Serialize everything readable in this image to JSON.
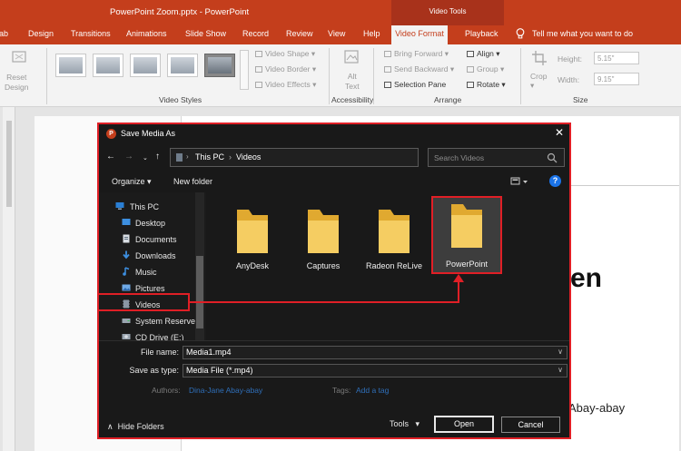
{
  "window": {
    "title": "PowerPoint Zoom.pptx  -  PowerPoint",
    "context_tab_group": "Video Tools"
  },
  "tabs": [
    {
      "label": "ab"
    },
    {
      "label": "Design"
    },
    {
      "label": "Transitions"
    },
    {
      "label": "Animations"
    },
    {
      "label": "Slide Show"
    },
    {
      "label": "Record"
    },
    {
      "label": "Review"
    },
    {
      "label": "View"
    },
    {
      "label": "Help"
    },
    {
      "label": "Video Format"
    },
    {
      "label": "Playback"
    }
  ],
  "tell_me": "Tell me what you want to do",
  "ribbon": {
    "reset_design": "Reset\nDesign",
    "video_shape": "Video Shape",
    "video_border": "Video Border",
    "video_effects": "Video Effects",
    "alt_text": "Alt\nText",
    "bring_forward": "Bring Forward",
    "send_backward": "Send Backward",
    "selection_pane": "Selection Pane",
    "align": "Align",
    "group": "Group",
    "rotate": "Rotate",
    "crop": "Crop",
    "height_label": "Height:",
    "height_value": "5.15\"",
    "width_label": "Width:",
    "width_value": "9.15\"",
    "group_video_styles": "Video Styles",
    "group_accessibility": "Accessibility",
    "group_arrange": "Arrange",
    "group_size": "Size"
  },
  "slide": {
    "heading_fragment": "en",
    "author_fragment": "Abay-abay"
  },
  "dialog": {
    "title": "Save Media As",
    "address_path": [
      "This PC",
      "Videos"
    ],
    "search_placeholder": "Search Videos",
    "organize": "Organize",
    "new_folder": "New folder",
    "nav_items": [
      {
        "label": "This PC",
        "icon": "pc-icon"
      },
      {
        "label": "Desktop",
        "icon": "desktop-icon"
      },
      {
        "label": "Documents",
        "icon": "documents-icon"
      },
      {
        "label": "Downloads",
        "icon": "downloads-icon"
      },
      {
        "label": "Music",
        "icon": "music-icon"
      },
      {
        "label": "Pictures",
        "icon": "pictures-icon"
      },
      {
        "label": "Videos",
        "icon": "videos-icon"
      },
      {
        "label": "System Reservec",
        "icon": "drive-icon"
      },
      {
        "label": "CD Drive (E:)",
        "icon": "cd-drive-icon"
      }
    ],
    "folders": [
      {
        "label": "AnyDesk"
      },
      {
        "label": "Captures"
      },
      {
        "label": "Radeon ReLive"
      },
      {
        "label": "PowerPoint",
        "selected": true
      }
    ],
    "file_name_label": "File name:",
    "file_name_value": "Media1.mp4",
    "save_as_type_label": "Save as type:",
    "save_as_type_value": "Media File (*.mp4)",
    "authors_label": "Authors:",
    "authors_value": "Dina-Jane Abay-abay",
    "tags_label": "Tags:",
    "tags_value": "Add a tag",
    "hide_folders": "Hide Folders",
    "tools": "Tools",
    "open": "Open",
    "cancel": "Cancel"
  },
  "colors": {
    "accent": "#c43e1c",
    "highlight": "#e01f26",
    "folder_yellow": "#f5cd62",
    "dialog_bg": "#191919",
    "link_blue": "#2f6fb9"
  }
}
